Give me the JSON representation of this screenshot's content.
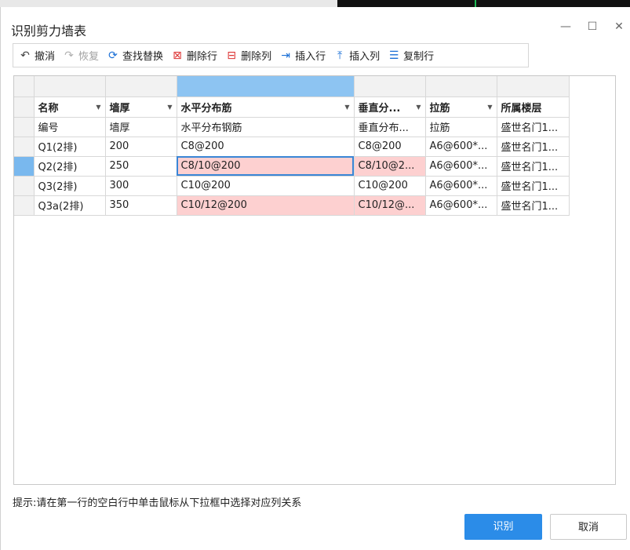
{
  "window": {
    "title": "识别剪力墙表"
  },
  "toolbar": {
    "undo": "撤消",
    "redo": "恢复",
    "find_replace": "查找替换",
    "delete_row": "删除行",
    "delete_col": "删除列",
    "insert_row": "插入行",
    "insert_col": "插入列",
    "copy_row": "复制行"
  },
  "table": {
    "headers": [
      "名称",
      "墙厚",
      "水平分布筋",
      "垂直分...",
      "拉筋",
      "所属楼层"
    ],
    "rows": [
      [
        "编号",
        "墙厚",
        "水平分布钢筋",
        "垂直分布...",
        "拉筋",
        "盛世名门1..."
      ],
      [
        "Q1(2排)",
        "200",
        "C8@200",
        "C8@200",
        "A6@600*...",
        "盛世名门1..."
      ],
      [
        "Q2(2排)",
        "250",
        "C8/10@200",
        "C8/10@2...",
        "A6@600*...",
        "盛世名门1..."
      ],
      [
        "Q3(2排)",
        "300",
        "C10@200",
        "C10@200",
        "A6@600*...",
        "盛世名门1..."
      ],
      [
        "Q3a(2排)",
        "350",
        "C10/12@200",
        "C10/12@...",
        "A6@600*...",
        "盛世名门1..."
      ]
    ]
  },
  "hint": "提示:请在第一行的空白行中单击鼠标从下拉框中选择对应列关系",
  "buttons": {
    "ok": "识别",
    "cancel": "取消"
  }
}
